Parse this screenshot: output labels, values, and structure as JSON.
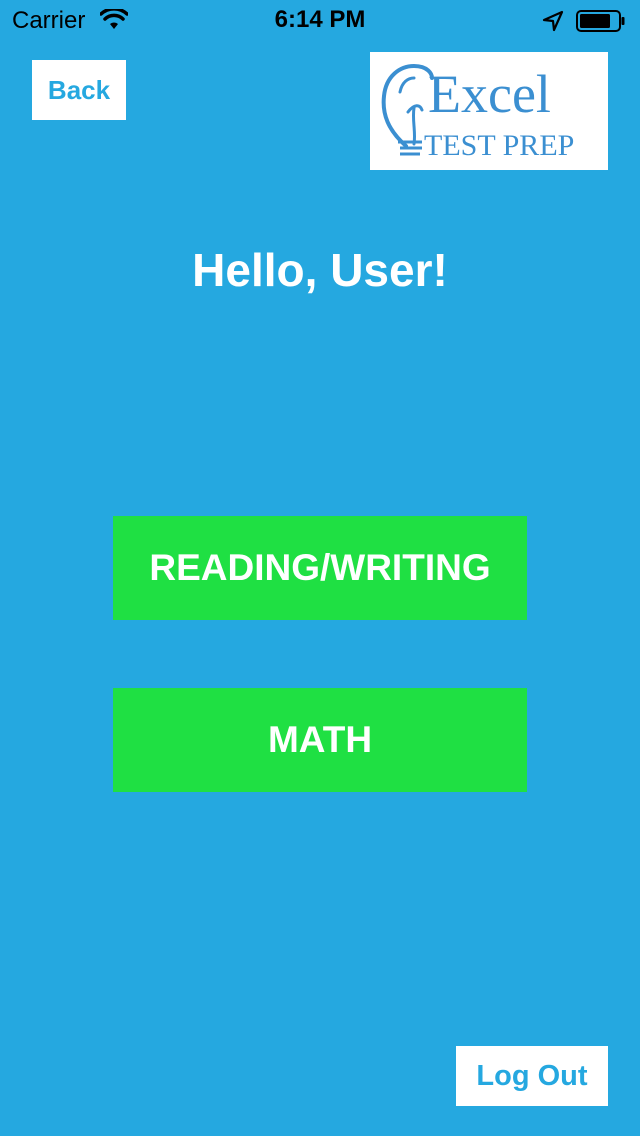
{
  "status_bar": {
    "carrier": "Carrier",
    "time": "6:14 PM"
  },
  "nav": {
    "back_label": "Back"
  },
  "logo": {
    "line1": "Excel",
    "line2": "TEST PREP"
  },
  "greeting": "Hello, User!",
  "subjects": {
    "reading_label": "READING/WRITING",
    "math_label": "MATH"
  },
  "footer": {
    "logout_label": "Log Out"
  },
  "colors": {
    "background": "#25a8e0",
    "button_green": "#1fe043",
    "white": "#ffffff",
    "logo_blue": "#3b8fd1"
  }
}
